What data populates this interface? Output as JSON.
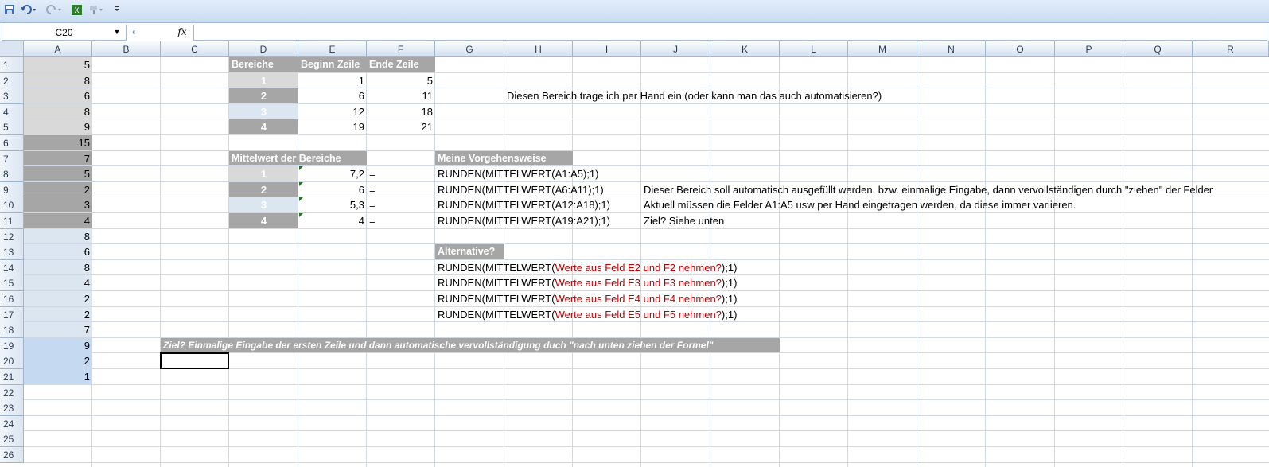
{
  "toolbar": {
    "save_icon": "save-icon",
    "undo_icon": "undo-icon",
    "redo_icon": "redo-icon",
    "excel_icon": "excel-icon",
    "format_icon": "format-painter-icon",
    "customize_icon": "chevron-down-icon"
  },
  "formula_bar": {
    "name_box": "C20",
    "fx_label": "fx",
    "formula": ""
  },
  "columns": [
    "A",
    "B",
    "C",
    "D",
    "E",
    "F",
    "G",
    "H",
    "I",
    "J",
    "K",
    "L",
    "M",
    "N",
    "O",
    "P",
    "Q",
    "R"
  ],
  "rows": [
    "1",
    "2",
    "3",
    "4",
    "5",
    "6",
    "7",
    "8",
    "9",
    "10",
    "11",
    "12",
    "13",
    "14",
    "15",
    "16",
    "17",
    "18",
    "19",
    "20",
    "21",
    "22",
    "23",
    "24",
    "25",
    "26"
  ],
  "colA": [
    "5",
    "8",
    "6",
    "8",
    "9",
    "15",
    "7",
    "5",
    "2",
    "3",
    "4",
    "8",
    "6",
    "8",
    "4",
    "2",
    "2",
    "7",
    "9",
    "2",
    "1"
  ],
  "colors": {
    "light_gray": "#d9d9d9",
    "dark_gray": "#a6a6a6",
    "light_blue": "#dce6f1",
    "blue": "#c5d9f1",
    "red_text": "#c00000"
  },
  "table1": {
    "headers": [
      "Bereiche",
      "Beginn Zeile",
      "Ende Zeile"
    ],
    "rows": [
      {
        "bereich": "1",
        "beginn": "1",
        "ende": "5"
      },
      {
        "bereich": "2",
        "beginn": "6",
        "ende": "11"
      },
      {
        "bereich": "3",
        "beginn": "12",
        "ende": "18"
      },
      {
        "bereich": "4",
        "beginn": "19",
        "ende": "21"
      }
    ],
    "note": "Diesen Bereich trage ich per Hand ein (oder kann man das auch automatisieren?)"
  },
  "table2": {
    "header": "Mittelwert der Bereiche",
    "rows": [
      {
        "bereich": "1",
        "wert": "7,2",
        "eq": "="
      },
      {
        "bereich": "2",
        "wert": "6",
        "eq": "="
      },
      {
        "bereich": "3",
        "wert": "5,3",
        "eq": "="
      },
      {
        "bereich": "4",
        "wert": "4",
        "eq": "="
      }
    ]
  },
  "vorgehen": {
    "header": "Meine Vorgehensweise",
    "formulas": [
      "RUNDEN(MITTELWERT(A1:A5);1)",
      "RUNDEN(MITTELWERT(A6:A11);1)",
      "RUNDEN(MITTELWERT(A12:A18);1)",
      "RUNDEN(MITTELWERT(A19:A21);1)"
    ],
    "notes": [
      "Dieser Bereich soll automatisch ausgefüllt werden, bzw. einmalige Eingabe, dann vervollständigen durch \"ziehen\" der Felder",
      "Aktuell müssen die Felder A1:A5 usw per Hand eingetragen werden, da diese immer variieren.",
      "Ziel? Siehe unten"
    ]
  },
  "alternative": {
    "header": "Alternative?",
    "prefix": "RUNDEN(MITTELWERT(",
    "suffix": ");1)",
    "red_parts": [
      "Werte aus Feld E2 und F2 nehmen?",
      "Werte aus Feld E3 und F3 nehmen?",
      "Werte aus Feld E4 und F4 nehmen?",
      "Werte aus Feld E5 und F5 nehmen?"
    ]
  },
  "ziel": "Ziel? Einmalige Eingabe der ersten Zeile und dann automatische vervollständigung duch \"nach unten ziehen der Formel\""
}
